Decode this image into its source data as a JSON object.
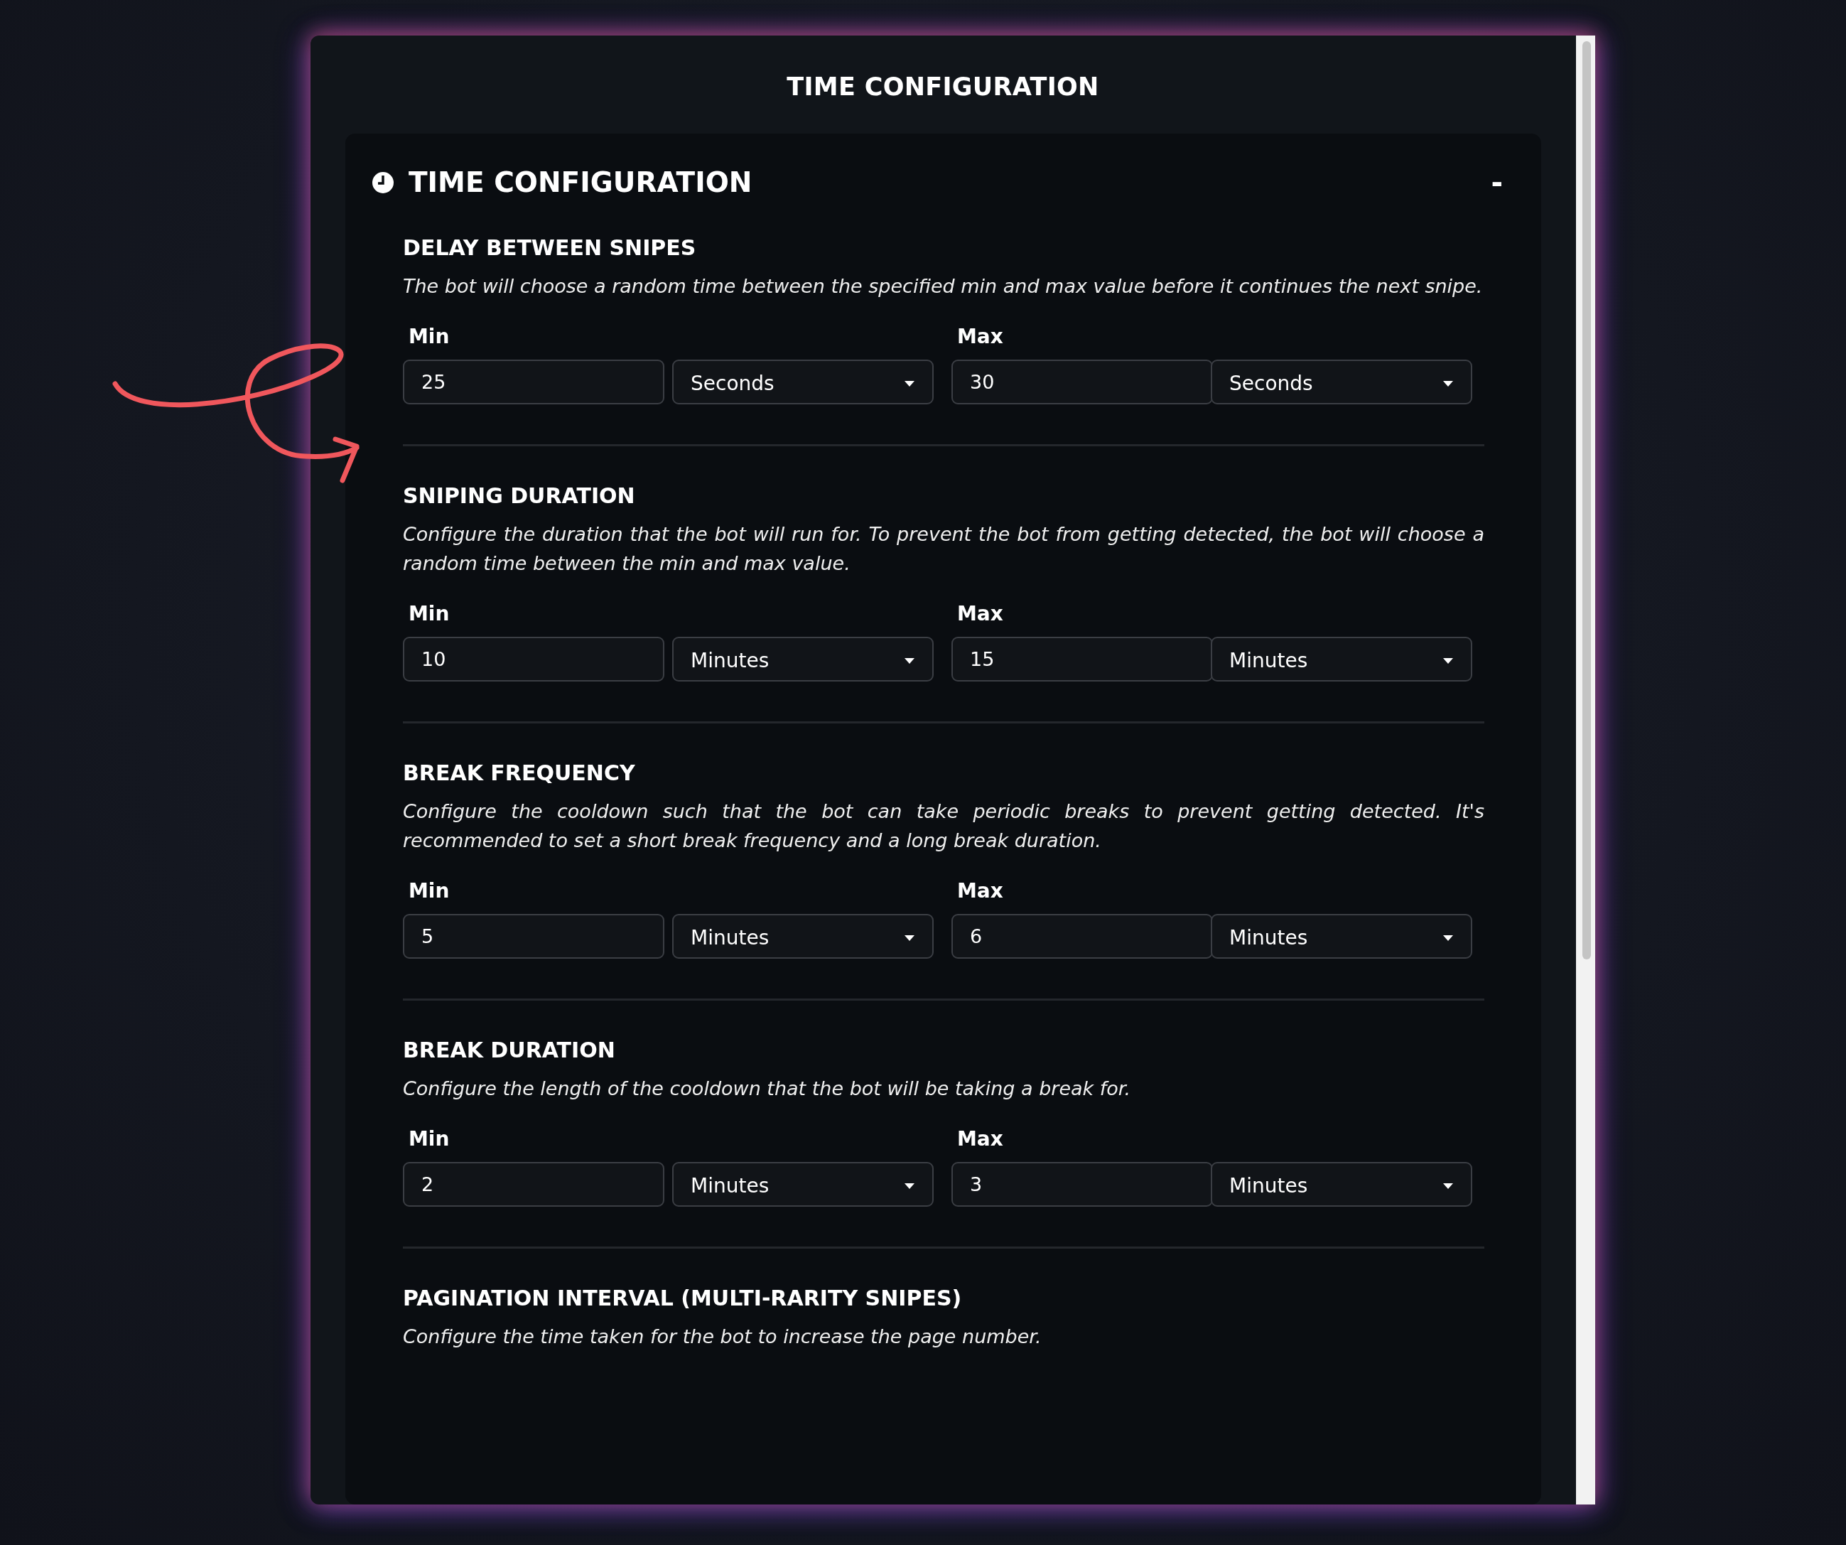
{
  "modal": {
    "title": "TIME CONFIGURATION"
  },
  "panel": {
    "title": "TIME CONFIGURATION",
    "collapse_symbol": "-",
    "expanded": true
  },
  "sections": [
    {
      "title": "DELAY BETWEEN SNIPES",
      "description": "The bot will choose a random time between the specified min and max value before it continues the next snipe.",
      "min_label": "Min",
      "min_value": "25",
      "min_unit": "Seconds",
      "max_label": "Max",
      "max_value": "30",
      "max_unit": "Seconds"
    },
    {
      "title": "SNIPING DURATION",
      "description": "Configure the duration that the bot will run for. To prevent the bot from getting detected, the bot will choose a random time between the min and max value.",
      "min_label": "Min",
      "min_value": "10",
      "min_unit": "Minutes",
      "max_label": "Max",
      "max_value": "15",
      "max_unit": "Minutes"
    },
    {
      "title": "BREAK FREQUENCY",
      "description": "Configure the cooldown such that the bot can take periodic breaks to prevent getting detected. It's recommended to set a short break frequency and a long break duration.",
      "min_label": "Min",
      "min_value": "5",
      "min_unit": "Minutes",
      "max_label": "Max",
      "max_value": "6",
      "max_unit": "Minutes"
    },
    {
      "title": "BREAK DURATION",
      "description": "Configure the length of the cooldown that the bot will be taking a break for.",
      "min_label": "Min",
      "min_value": "2",
      "min_unit": "Minutes",
      "max_label": "Max",
      "max_value": "3",
      "max_unit": "Minutes"
    },
    {
      "title": "PAGINATION INTERVAL (MULTI-RARITY SNIPES)",
      "description": "Configure the time taken for the bot to increase the page number."
    }
  ]
}
